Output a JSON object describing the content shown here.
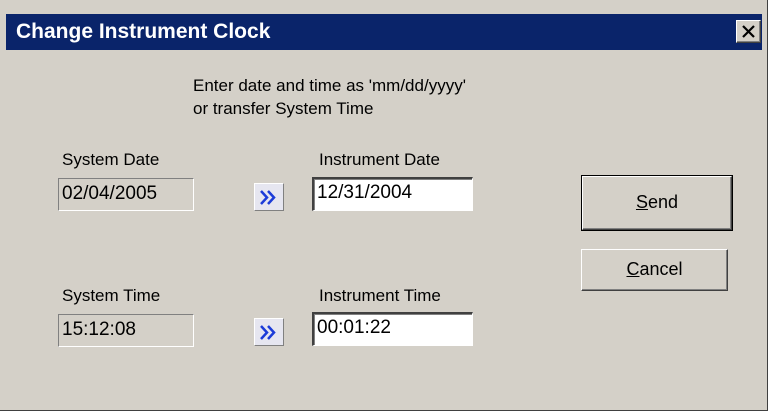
{
  "dialog": {
    "title": "Change Instrument Clock",
    "instructions_line1": "Enter date and time as 'mm/dd/yyyy'",
    "instructions_line2": "or transfer System Time"
  },
  "system": {
    "date_label": "System Date",
    "date_value": "02/04/2005",
    "time_label": "System Time",
    "time_value": "15:12:08"
  },
  "instrument": {
    "date_label": "Instrument Date",
    "date_value": "12/31/2004",
    "time_label": "Instrument Time",
    "time_value": "00:01:22"
  },
  "buttons": {
    "send_mnemonic": "S",
    "send_rest": "end",
    "cancel_mnemonic": "C",
    "cancel_rest": "ancel"
  },
  "icons": {
    "close": "close-x-icon",
    "transfer": "double-chevron-right-icon"
  },
  "colors": {
    "titlebar": "#0a246a",
    "dialog_face": "#d4d0c8",
    "transfer_arrow": "#1c3cd8"
  }
}
